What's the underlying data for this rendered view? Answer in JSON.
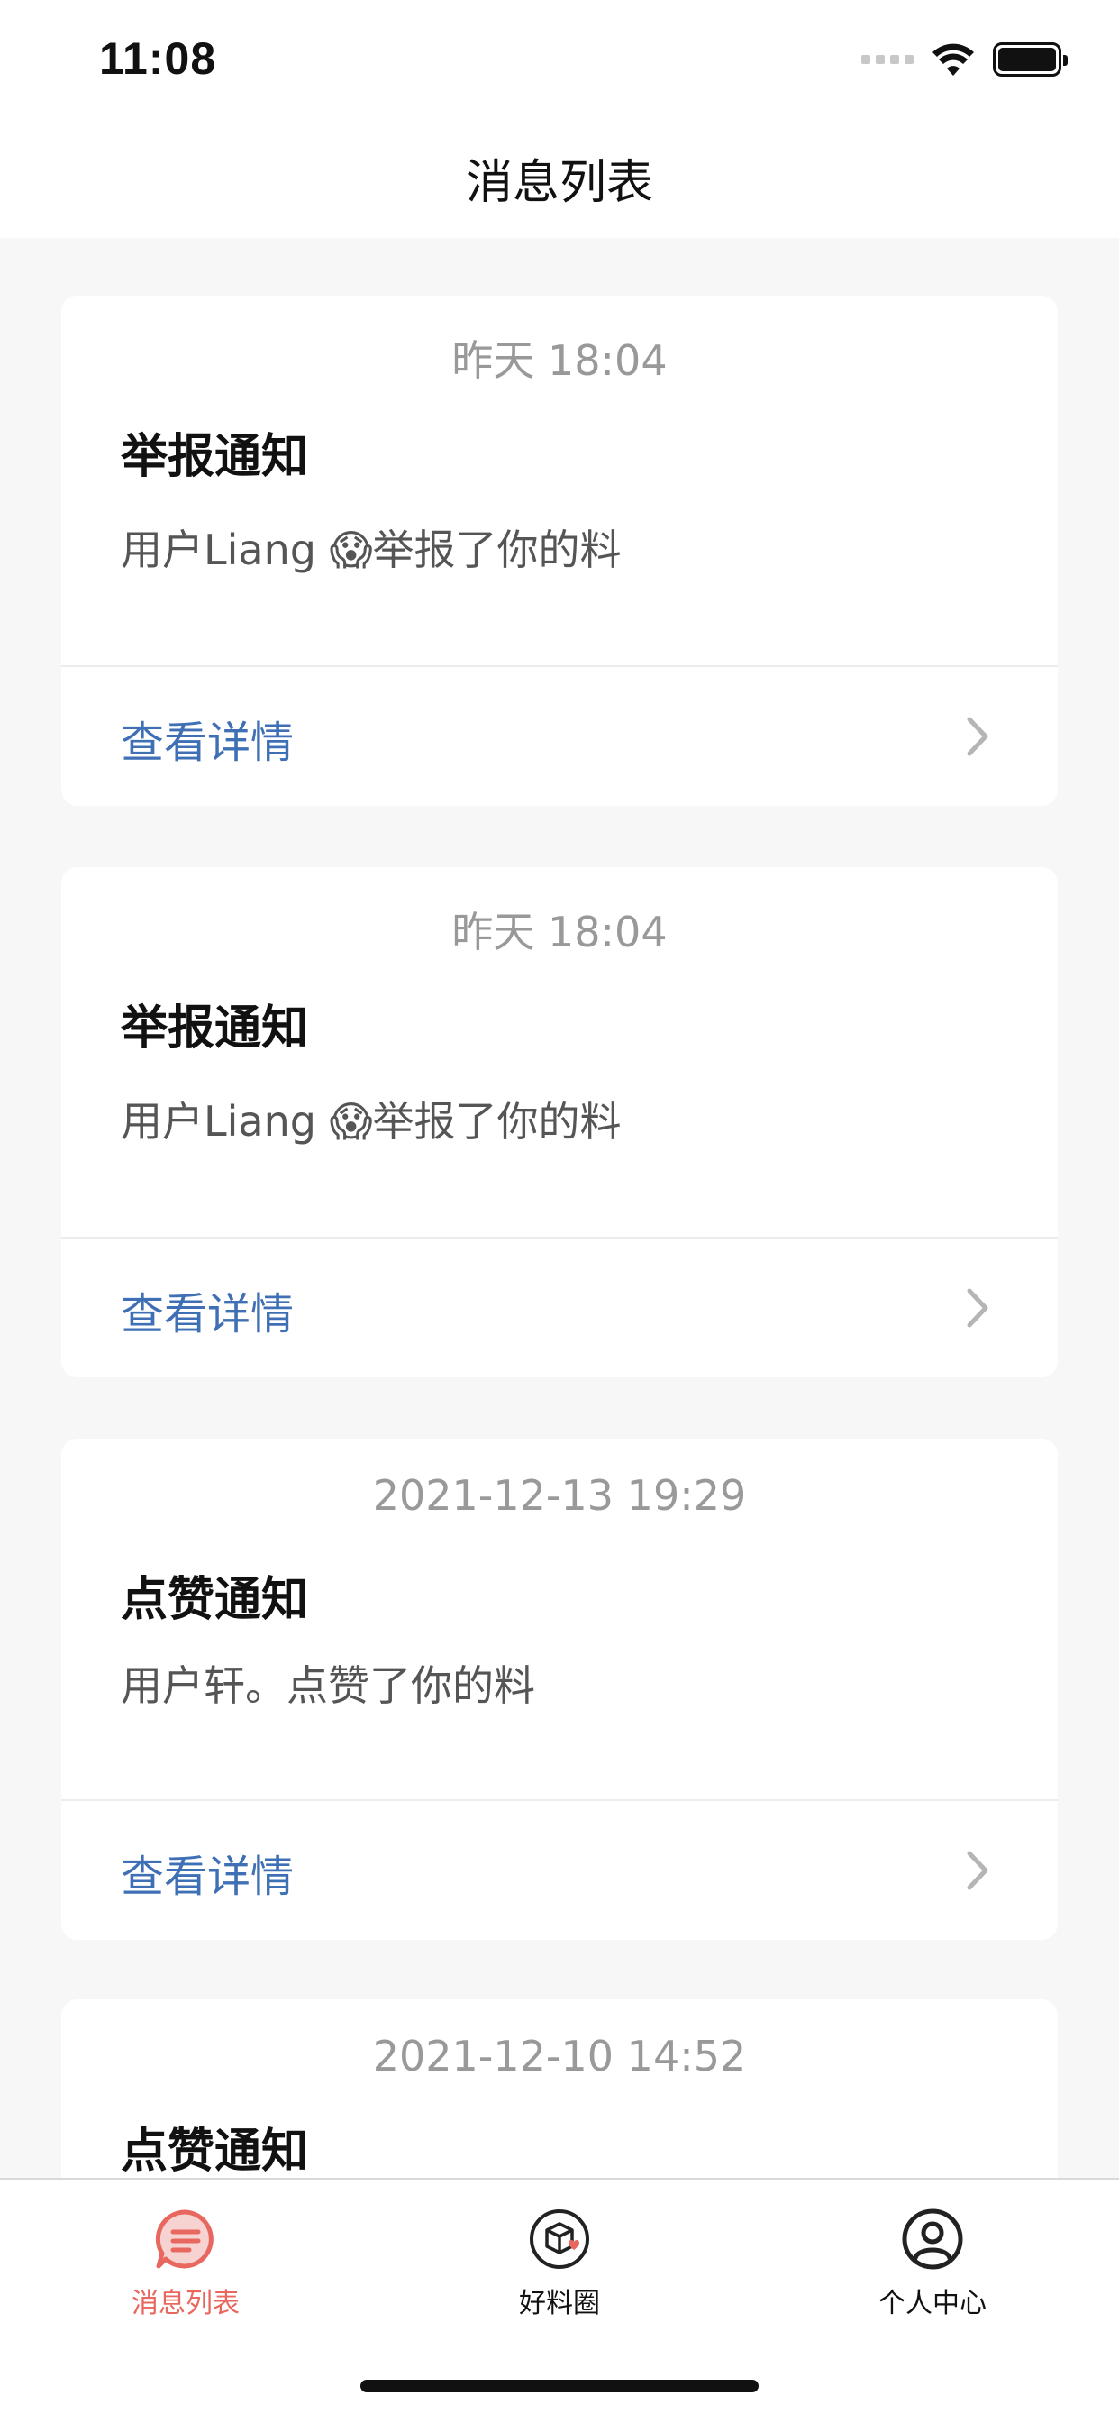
{
  "status": {
    "time": "11:08"
  },
  "nav": {
    "title": "消息列表"
  },
  "messages": [
    {
      "time": "昨天 18:04",
      "title": "举报通知",
      "body": "用户Liang 😱举报了你的料",
      "action": "查看详情"
    },
    {
      "time": "昨天 18:04",
      "title": "举报通知",
      "body": "用户Liang 😱举报了你的料",
      "action": "查看详情"
    },
    {
      "time": "2021-12-13 19:29",
      "title": "点赞通知",
      "body": "用户轩。点赞了你的料",
      "action": "查看详情"
    },
    {
      "time": "2021-12-10 14:52",
      "title": "点赞通知",
      "body": "",
      "action": ""
    }
  ],
  "tabs": [
    {
      "label": "消息列表",
      "icon": "message-list-icon",
      "active": true
    },
    {
      "label": "好料圈",
      "icon": "box-circle-icon",
      "active": false
    },
    {
      "label": "个人中心",
      "icon": "user-circle-icon",
      "active": false
    }
  ],
  "colors": {
    "accent": "#e8675f",
    "link": "#3f6fb5",
    "muted": "#999999",
    "background": "#f7f7f7"
  }
}
